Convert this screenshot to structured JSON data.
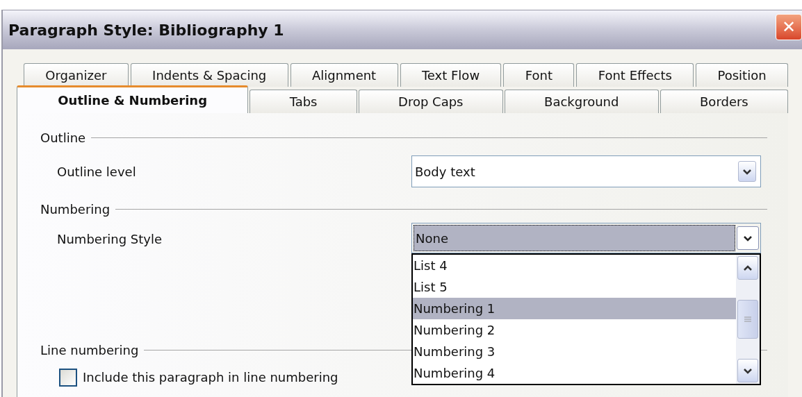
{
  "window": {
    "title": "Paragraph Style: Bibliography 1",
    "close": "✕"
  },
  "tabs": [
    [
      {
        "label": "Organizer",
        "selected": false
      },
      {
        "label": "Indents & Spacing",
        "selected": false
      },
      {
        "label": "Alignment",
        "selected": false
      },
      {
        "label": "Text Flow",
        "selected": false
      },
      {
        "label": "Font",
        "selected": false
      },
      {
        "label": "Font Effects",
        "selected": false
      },
      {
        "label": "Position",
        "selected": false
      }
    ],
    [
      {
        "label": "Outline & Numbering",
        "selected": true
      },
      {
        "label": "Tabs",
        "selected": false
      },
      {
        "label": "Drop Caps",
        "selected": false
      },
      {
        "label": "Background",
        "selected": false
      },
      {
        "label": "Borders",
        "selected": false
      }
    ]
  ],
  "outline": {
    "heading": "Outline",
    "level_label": "Outline level",
    "level_value": "Body text"
  },
  "numbering": {
    "heading": "Numbering",
    "style_label": "Numbering Style",
    "style_value": "None",
    "expanded": true,
    "options": [
      {
        "label": "List 4",
        "selected": false
      },
      {
        "label": "List 5",
        "selected": false
      },
      {
        "label": "Numbering 1",
        "selected": true
      },
      {
        "label": "Numbering 2",
        "selected": false
      },
      {
        "label": "Numbering 3",
        "selected": false
      },
      {
        "label": "Numbering 4",
        "selected": false
      }
    ]
  },
  "line_numbering": {
    "heading": "Line numbering",
    "checkbox_label": "Include this paragraph in line numbering",
    "checked": false
  }
}
